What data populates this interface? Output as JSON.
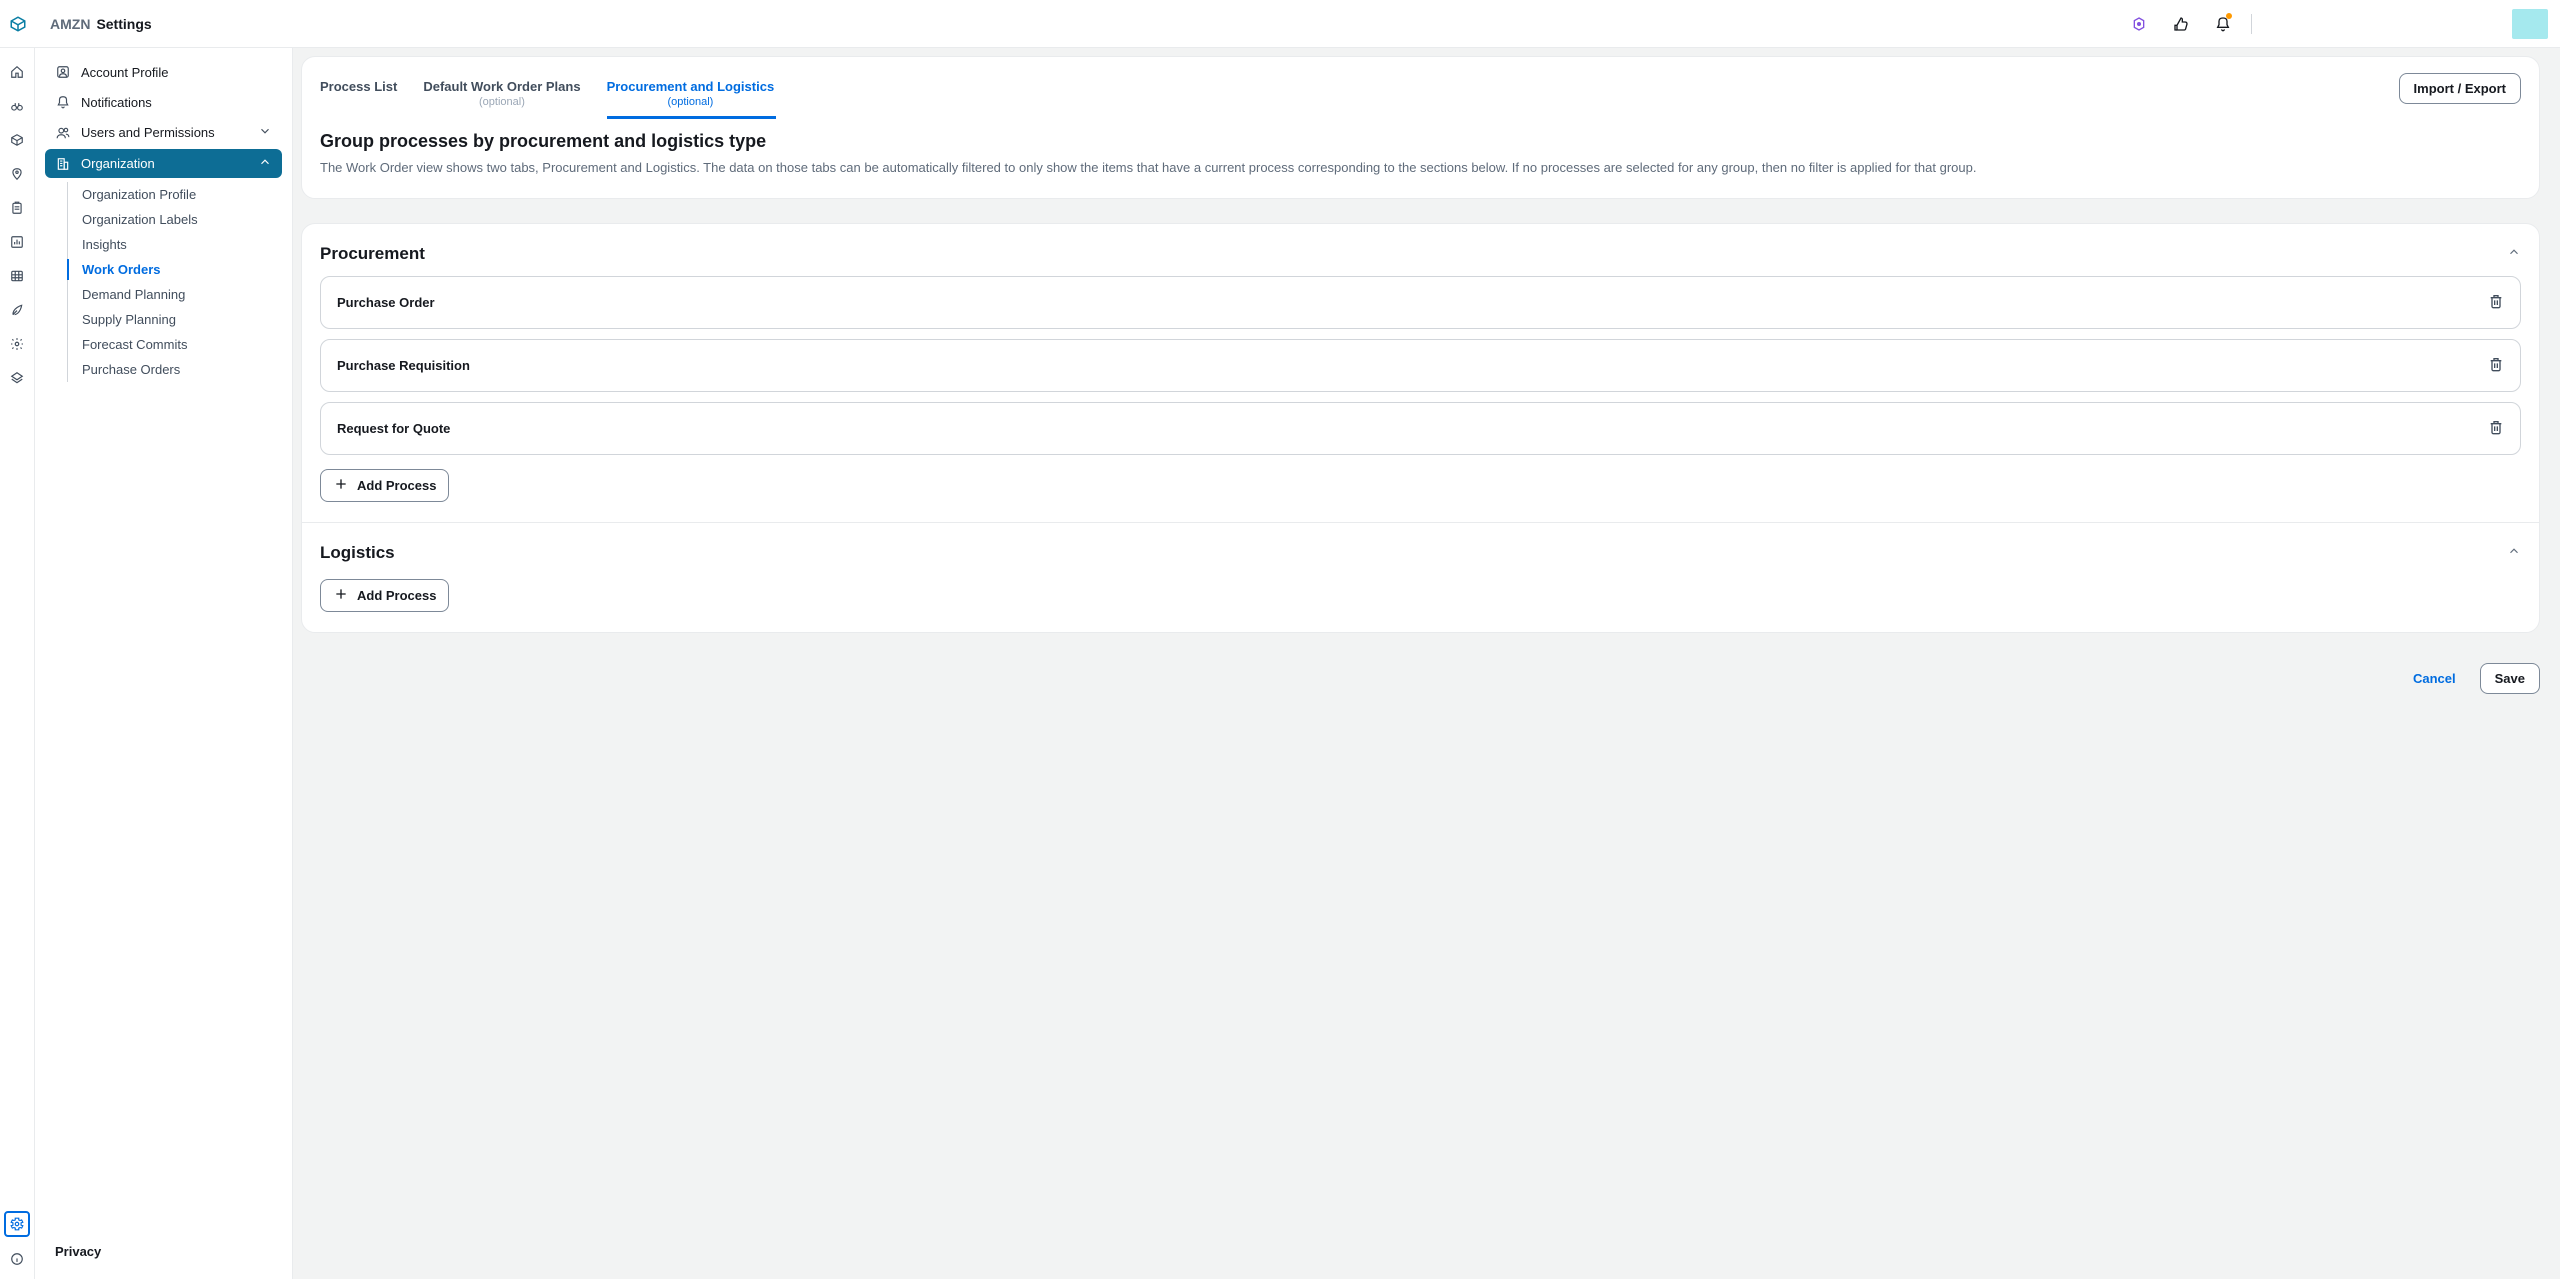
{
  "header": {
    "org": "AMZN",
    "page_title": "Settings"
  },
  "top_actions": {
    "ai_icon": "ai-assistant",
    "feedback_icon": "feedback",
    "notifications_icon": "notifications"
  },
  "rail": {
    "items": [
      {
        "name": "home-icon"
      },
      {
        "name": "binoculars-icon"
      },
      {
        "name": "cube-icon"
      },
      {
        "name": "location-pin-icon"
      },
      {
        "name": "clipboard-icon"
      },
      {
        "name": "bar-chart-icon"
      },
      {
        "name": "data-table-icon"
      },
      {
        "name": "leaf-icon"
      },
      {
        "name": "gear-small-icon"
      },
      {
        "name": "layers-diamond-icon"
      }
    ],
    "bottom": [
      {
        "name": "settings-gear-icon",
        "active": true
      },
      {
        "name": "info-circle-icon"
      }
    ]
  },
  "sidebar": {
    "items": [
      {
        "label": "Account Profile",
        "icon": "user-square-icon"
      },
      {
        "label": "Notifications",
        "icon": "bell-icon"
      },
      {
        "label": "Users and Permissions",
        "icon": "people-icon",
        "expandable": true,
        "expanded": false
      },
      {
        "label": "Organization",
        "icon": "building-icon",
        "expandable": true,
        "expanded": true,
        "selected": true
      }
    ],
    "org_sub": [
      {
        "label": "Organization Profile"
      },
      {
        "label": "Organization Labels"
      },
      {
        "label": "Insights"
      },
      {
        "label": "Work Orders",
        "active": true
      },
      {
        "label": "Demand Planning"
      },
      {
        "label": "Supply Planning"
      },
      {
        "label": "Forecast Commits"
      },
      {
        "label": "Purchase Orders"
      }
    ],
    "privacy_label": "Privacy"
  },
  "tabs": [
    {
      "label": "Process List",
      "sub": ""
    },
    {
      "label": "Default Work Order Plans",
      "sub": "(optional)"
    },
    {
      "label": "Procurement and Logistics",
      "sub": "(optional)",
      "active": true
    }
  ],
  "buttons": {
    "import_export": "Import / Export",
    "add_process": "Add Process",
    "cancel": "Cancel",
    "save": "Save"
  },
  "page": {
    "heading": "Group processes by procurement and logistics type",
    "description": "The Work Order view shows two tabs, Procurement and Logistics. The data on those tabs can be automatically filtered to only show the items that have a current process corresponding to the sections below. If no processes are selected for any group, then no filter is applied for that group."
  },
  "groups": [
    {
      "title": "Procurement",
      "processes": [
        {
          "name": "Purchase Order"
        },
        {
          "name": "Purchase Requisition"
        },
        {
          "name": "Request for Quote"
        }
      ]
    },
    {
      "title": "Logistics",
      "processes": []
    }
  ]
}
